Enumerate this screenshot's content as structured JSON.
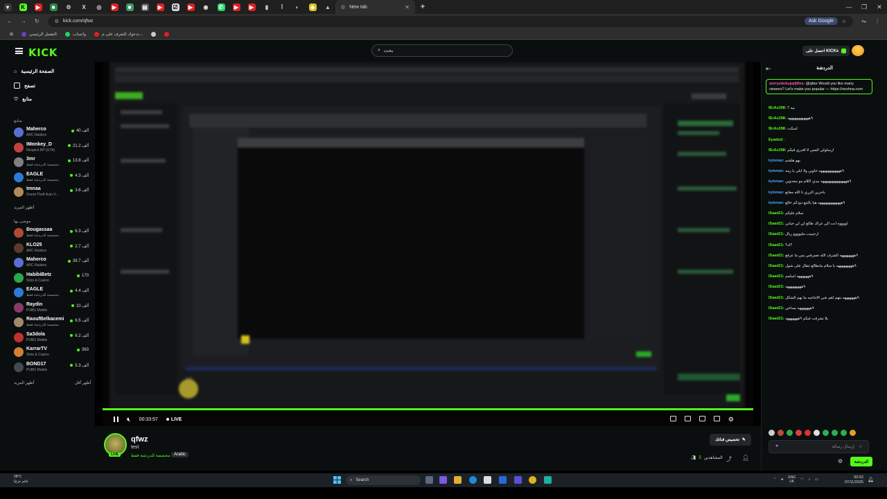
{
  "browser": {
    "active_tab_title": "New tab",
    "url": "kick.com/qfwz",
    "ask_google": "Ask Google",
    "bookmarks": [
      "التفعيل الرئيسي",
      "واتساب",
      "تدعوك للتعرف على م...",
      ""
    ]
  },
  "kick": {
    "logo": "KICK",
    "search_placeholder": "بحث",
    "get_kicks": "احصل على KICKs",
    "nav": [
      "الصفحة الرئيسية",
      "تصفح",
      "متابع"
    ],
    "following_title": "متابع",
    "following": [
      {
        "name": "Maherco",
        "category": "ARC Raiders",
        "viewers": "40 ألف",
        "color": "#5a6fd6"
      },
      {
        "name": "IMonkey_D",
        "category": "Respect RP (GTA)",
        "viewers": "21.2 ألف",
        "color": "#c24040"
      },
      {
        "name": "3mr",
        "category": "مخصصة للدردشة فقط",
        "viewers": "13.8 ألف",
        "color": "#808080"
      },
      {
        "name": "EAGLE",
        "category": "مخصصة للدردشة فقط",
        "viewers": "4.3 ألف",
        "color": "#2d7bd6"
      },
      {
        "name": "tmnaa",
        "category": "Grand Theft Auto V...",
        "viewers": "3.6 ألف",
        "color": "#b08a5a"
      }
    ],
    "show_more_1": "أظهر المزيد",
    "recommended_title": "موصى بها",
    "recommended": [
      {
        "name": "Bougassaa",
        "category": "مخصصة للدردشة فقط",
        "viewers": "6.3 ألف",
        "color": "#b04a30"
      },
      {
        "name": "KLO25",
        "category": "ARC Raiders",
        "viewers": "2.7 ألف",
        "color": "#5a3a2a"
      },
      {
        "name": "Maherco",
        "category": "ARC Raiders",
        "viewers": "39.7 ألف",
        "color": "#5a6fd6"
      },
      {
        "name": "HabibiBetz",
        "category": "Slots & Casino",
        "viewers": "170",
        "color": "#2aa84a"
      },
      {
        "name": "EAGLE",
        "category": "مخصصة للدردشة فقط",
        "viewers": "4.4 ألف",
        "color": "#2d7bd6"
      },
      {
        "name": "Raydin",
        "category": "PUBG Mobile",
        "viewers": "10 ألف",
        "color": "#8a3a6a"
      },
      {
        "name": "RaoufBelkacemi",
        "category": "مخصصة للدردشة فقط",
        "viewers": "6.5 ألف",
        "color": "#a08a6a"
      },
      {
        "name": "Sa3dola",
        "category": "PUBG Mobile",
        "viewers": "6.2 ألف",
        "color": "#c03030"
      },
      {
        "name": "KarrarTV",
        "category": "Slots & Casino",
        "viewers": "363",
        "color": "#d08030"
      },
      {
        "name": "BOND17",
        "category": "PUBG Mobile",
        "viewers": "5.3 ألف",
        "color": "#404a50"
      }
    ],
    "show_more_2": "أظهر المزيد",
    "show_less": "أظهر أقل"
  },
  "player": {
    "time": "00:33:57",
    "live": "LIVE",
    "progress": 1.0
  },
  "stream": {
    "streamer": "qfwz",
    "title": "test",
    "category": "مخصصة للدردشة فقط",
    "language": "Arabic",
    "live_badge": "LIVE",
    "customize": "تخصيص قناتك",
    "viewers_label": "المشاهدين",
    "viewers_count": "5"
  },
  "chat": {
    "title": "الدردشة",
    "pinned": {
      "user": "sorrystickupqfjifns:",
      "text": "@qfwz Would you like many viewers? Let's make you popular — https://nezhna.com"
    },
    "messages": [
      {
        "user": "fErAs398:",
        "text": "بيه ؟",
        "color": "#53fc18"
      },
      {
        "user": "fErAs398:",
        "text": "٩ههههههههههههه",
        "color": "#53fc18"
      },
      {
        "user": "fErAs398:",
        "text": "اسكت",
        "color": "#53fc18"
      },
      {
        "user": "Eyadud:",
        "text": ".",
        "color": "#53fc18"
      },
      {
        "user": "fErAs398:",
        "text": "ارسلولي الفس لا اقدري قيكم",
        "color": "#53fc18"
      },
      {
        "user": "kytenao:",
        "text": "بهو هلشم",
        "color": "#4aa8ff"
      },
      {
        "user": "kytenao:",
        "text": "٩ههههههههههههه خاوين ولا ابلى يا زمه",
        "color": "#4aa8ff"
      },
      {
        "user": "kytenao:",
        "text": "٩هههههههههههههههه بيدي اكلام مو مجدوين",
        "color": "#4aa8ff"
      },
      {
        "user": "kytenao:",
        "text": "ياخرين الزري تا الله معاتع",
        "color": "#4aa8ff"
      },
      {
        "user": "kytenao:",
        "text": "٩هههههههههههههه هيا يالتبع دودكم خالع",
        "color": "#4aa8ff"
      },
      {
        "user": "ISaad21:",
        "text": "سلام عليكم",
        "color": "#53fc18"
      },
      {
        "user": "ISaad21:",
        "text": "اووووه انت الي عراك طالع لي لي حياني",
        "color": "#53fc18"
      },
      {
        "user": "ISaad21:",
        "text": "ارحيبيب مليوووو ريال",
        "color": "#53fc18"
      },
      {
        "user": "ISaad21:",
        "text": "؟اه؟",
        "color": "#53fc18"
      },
      {
        "user": "ISaad21:",
        "text": "٩ههههههههه الشرف اللّه تعمرفني يس ما عرفع",
        "color": "#53fc18"
      },
      {
        "user": "ISaad21:",
        "text": "٩هههههههههه يا سلام مابطالع تتقال على شول",
        "color": "#53fc18"
      },
      {
        "user": "ISaad21:",
        "text": "٩هههههههه اسلمم",
        "color": "#53fc18"
      },
      {
        "user": "ISaad21:",
        "text": "٩هههههههههه",
        "color": "#53fc18"
      },
      {
        "user": "ISaad21:",
        "text": "٩هههههههه يتهم اهم شي الانتاجيه ما يهم الشكل",
        "color": "#53fc18"
      },
      {
        "user": "ISaad21:",
        "text": "٩هههههههه يساعي",
        "color": "#53fc18"
      },
      {
        "user": "ISaad21:",
        "text": "يلا تشرفت فيكم ٩هههههههه",
        "color": "#53fc18"
      }
    ],
    "input_placeholder": "إرسال رسالة",
    "send_button": "الدردشة"
  },
  "taskbar": {
    "temperature": "28°C",
    "weather": "غائم جزئيًا",
    "search": "Search",
    "lang_top": "ENG",
    "lang_bottom": "UK",
    "time": "00:52",
    "date": "07/11/2025"
  }
}
